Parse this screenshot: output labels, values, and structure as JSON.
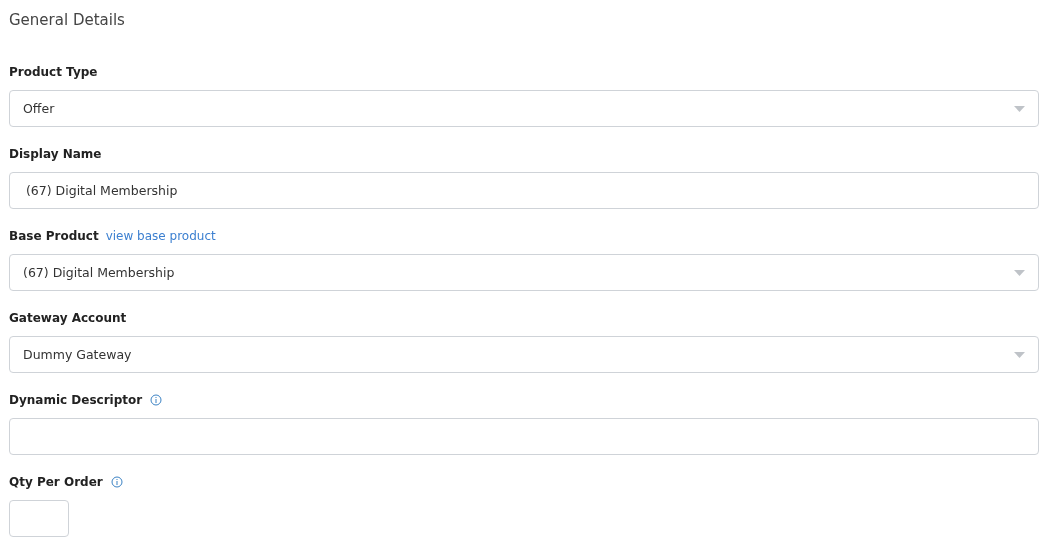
{
  "title": "General Details",
  "fields": [
    {
      "kind": "select",
      "label": "Product Type",
      "value": "Offer"
    },
    {
      "kind": "text",
      "label": "Display Name",
      "value": " (67) Digital Membership"
    },
    {
      "kind": "select",
      "label": "Base Product",
      "link": "view base product",
      "value": "(67) Digital Membership"
    },
    {
      "kind": "select",
      "label": "Gateway Account",
      "value": "Dummy Gateway"
    },
    {
      "kind": "text",
      "label": "Dynamic Descriptor",
      "info": true
    },
    {
      "kind": "small",
      "label": "Qty Per Order",
      "info": true
    }
  ]
}
